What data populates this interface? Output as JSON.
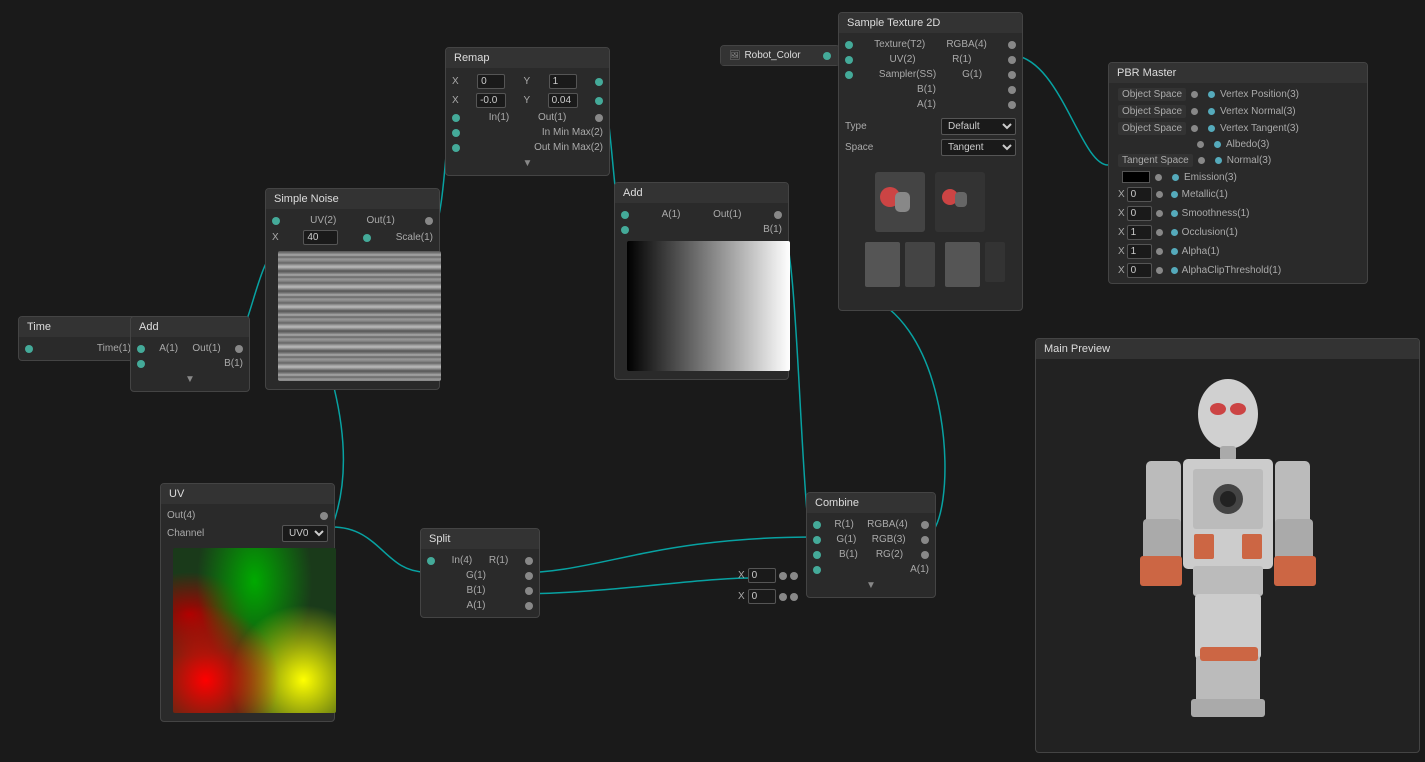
{
  "nodes": {
    "time": {
      "title": "Time",
      "ports": [
        {
          "label": "Time(1)",
          "type": "out"
        }
      ]
    },
    "add1": {
      "title": "Add",
      "inputs": [
        "A(1)",
        "B(1)"
      ],
      "outputs": [
        "Out(1)"
      ]
    },
    "add2": {
      "title": "Add",
      "inputs": [
        "A(1)",
        "B(1)"
      ],
      "outputs": [
        "Out(1)"
      ]
    },
    "simpleNoise": {
      "title": "Simple Noise",
      "inputs": [
        "UV(2)",
        "Scale(1)"
      ],
      "outputs": [
        "Out(1)"
      ],
      "scale_value": "40"
    },
    "remap": {
      "title": "Remap",
      "inputs": [
        "In(1)",
        "In Min Max(2)",
        "Out Min Max(2)"
      ],
      "outputs": [
        "Out(1)"
      ],
      "x1": "0",
      "y1": "1",
      "x2": "-0.0",
      "y2": "0.04"
    },
    "uv": {
      "title": "UV",
      "outputs": [
        "Out(4)"
      ],
      "channel_label": "Channel",
      "channel_value": "UV0"
    },
    "split": {
      "title": "Split",
      "inputs": [
        "In(4)"
      ],
      "outputs": [
        "R(1)",
        "G(1)",
        "B(1)",
        "A(1)"
      ]
    },
    "combine": {
      "title": "Combine",
      "inputs": [
        "R(1)",
        "G(1)",
        "B(1)",
        "A(1)"
      ],
      "outputs": [
        "RGBA(4)",
        "RGB(3)",
        "RG(2)"
      ],
      "x1": "0",
      "x2": "0"
    },
    "sampleTexture": {
      "title": "Sample Texture 2D",
      "inputs": [
        "Texture(T2)",
        "UV(2)",
        "Sampler(SS)"
      ],
      "outputs": [
        "RGBA(4)",
        "R(1)",
        "G(1)",
        "B(1)",
        "A(1)"
      ],
      "type_label": "Type",
      "type_value": "Default",
      "space_label": "Space",
      "space_value": "Tangent"
    },
    "robotColor": {
      "title": "Robot_Color"
    },
    "pbrMaster": {
      "title": "PBR Master",
      "rows": [
        {
          "label": "Object Space",
          "port_in": true,
          "output": "Vertex Position(3)"
        },
        {
          "label": "Object Space",
          "port_in": true,
          "output": "Vertex Normal(3)"
        },
        {
          "label": "Object Space",
          "port_in": true,
          "output": "Vertex Tangent(3)"
        },
        {
          "label": "",
          "port_in": false,
          "output": "Albedo(3)"
        },
        {
          "label": "Tangent Space",
          "port_in": true,
          "output": "Normal(3)"
        },
        {
          "label": "",
          "port_in": false,
          "output": "Emission(3)",
          "swatch": true
        },
        {
          "label": "X 0",
          "port_in": false,
          "output": "Metallic(1)"
        },
        {
          "label": "X 0",
          "port_in": false,
          "output": "Smoothness(1)"
        },
        {
          "label": "X 1",
          "port_in": false,
          "output": "Occlusion(1)"
        },
        {
          "label": "X 1",
          "port_in": false,
          "output": "Alpha(1)"
        },
        {
          "label": "X 0",
          "port_in": false,
          "output": "AlphaClipThreshold(1)"
        }
      ]
    },
    "mainPreview": {
      "title": "Main Preview"
    }
  }
}
